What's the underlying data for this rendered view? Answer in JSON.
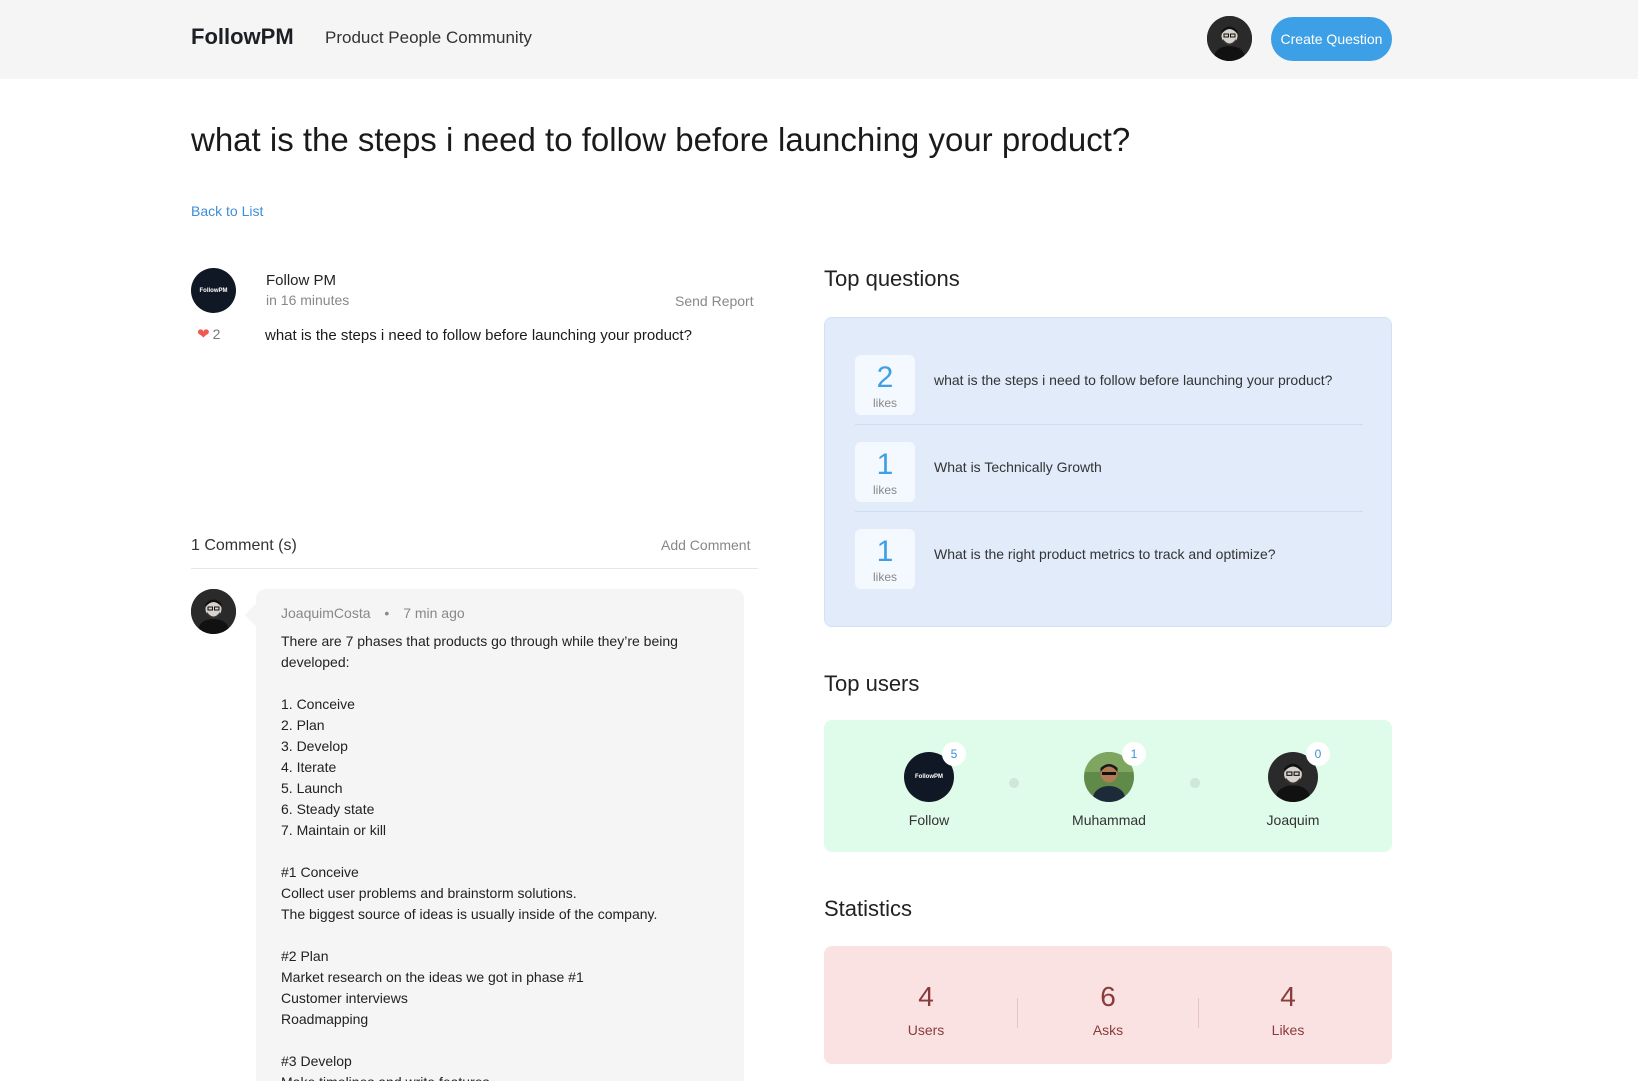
{
  "header": {
    "brand": "FollowPM",
    "tagline": "Product People Community",
    "create_button": "Create Question"
  },
  "question": {
    "title": "what is the steps i need to follow before launching your product?",
    "back_link": "Back to List",
    "author": "Follow PM",
    "avatar_text": "FollowPM",
    "time": "in 16 minutes",
    "send_report": "Send Report",
    "likes": "2",
    "body": "what is the steps i need to follow before launching your product?"
  },
  "comments": {
    "count_label": "1 Comment (s)",
    "add_label": "Add Comment",
    "items": [
      {
        "author": "JoaquimCosta",
        "separator": "•",
        "time": "7 min ago",
        "text": "There are 7 phases that products go through while they’re being developed:\n\n1. Conceive\n2. Plan\n3. Develop\n4. Iterate\n5. Launch\n6. Steady state\n7. Maintain or kill\n\n#1 Conceive\nCollect user problems and brainstorm solutions.\nThe biggest source of ideas is usually inside of the company.\n\n#2 Plan\nMarket research on the ideas we got in phase #1\nCustomer interviews\nRoadmapping\n\n#3 Develop\nMake timelines and write features"
      }
    ]
  },
  "top_questions": {
    "title": "Top questions",
    "items": [
      {
        "likes": "2",
        "likes_label": "likes",
        "text": "what is the steps i need to follow before launching your product?"
      },
      {
        "likes": "1",
        "likes_label": "likes",
        "text": "What is Technically Growth"
      },
      {
        "likes": "1",
        "likes_label": "likes",
        "text": "What is the right product metrics to track and optimize?"
      }
    ]
  },
  "top_users": {
    "title": "Top users",
    "items": [
      {
        "name": "Follow",
        "count": "5",
        "avatar_text": "FollowPM"
      },
      {
        "name": "Muhammad",
        "count": "1"
      },
      {
        "name": "Joaquim",
        "count": "0"
      }
    ]
  },
  "statistics": {
    "title": "Statistics",
    "items": [
      {
        "value": "4",
        "label": "Users"
      },
      {
        "value": "6",
        "label": "Asks"
      },
      {
        "value": "4",
        "label": "Likes"
      }
    ]
  },
  "colors": {
    "accent": "#3d9fe6",
    "top_questions_bg": "#e1ebfa",
    "top_users_bg": "#dffbea",
    "statistics_bg": "#fae2e2",
    "heart": "#ee5a52"
  }
}
